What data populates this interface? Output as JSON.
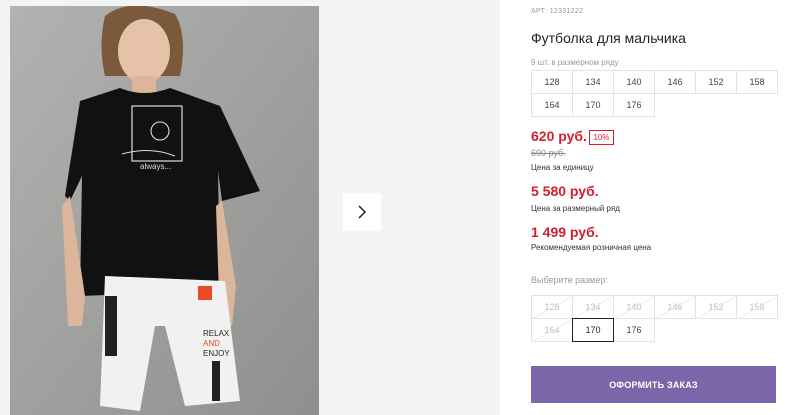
{
  "product": {
    "article": "АРТ: 12331222",
    "title": "Футболка для мальчика",
    "row_note": "9 шт. в размерном ряду",
    "row_sizes": [
      "128",
      "134",
      "140",
      "146",
      "152",
      "158",
      "164",
      "170",
      "176"
    ],
    "price": "620 руб.",
    "discount": "10%",
    "old_price": "690 руб.",
    "unit_price_note": "Цена за единицу",
    "lot_price": "5 580 руб.",
    "lot_price_note": "Цена за размерный ряд",
    "rrp": "1 499 руб.",
    "rrp_note": "Рекомендуемая розничная цена"
  },
  "size_picker": {
    "label": "Выберите размер:",
    "sizes": [
      {
        "label": "128",
        "available": false
      },
      {
        "label": "134",
        "available": false
      },
      {
        "label": "140",
        "available": false
      },
      {
        "label": "146",
        "available": false
      },
      {
        "label": "152",
        "available": false
      },
      {
        "label": "158",
        "available": false
      },
      {
        "label": "164",
        "available": false
      },
      {
        "label": "170",
        "available": true,
        "selected": true
      },
      {
        "label": "176",
        "available": true
      }
    ]
  },
  "order_button": "ОФОРМИТЬ ЗАКАЗ",
  "photo": {
    "shirt_print": "always...",
    "shorts_print": [
      "RELAX",
      "AND",
      "ENJOY"
    ]
  },
  "colors": {
    "accent": "#7a66a8",
    "price_red": "#d22030"
  }
}
